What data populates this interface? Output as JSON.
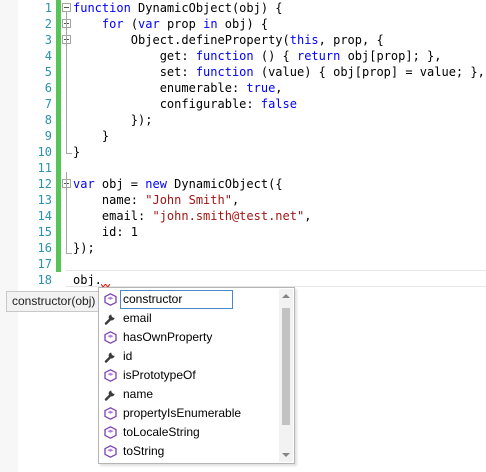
{
  "editor": {
    "lines": [
      {
        "num": "1",
        "tokens": [
          [
            "kw",
            "function"
          ],
          [
            "plain",
            " DynamicObject(obj) {"
          ]
        ]
      },
      {
        "num": "2",
        "tokens": [
          [
            "plain",
            "    "
          ],
          [
            "kw",
            "for"
          ],
          [
            "plain",
            " ("
          ],
          [
            "kw",
            "var"
          ],
          [
            "plain",
            " prop "
          ],
          [
            "kw",
            "in"
          ],
          [
            "plain",
            " obj) {"
          ]
        ]
      },
      {
        "num": "3",
        "tokens": [
          [
            "plain",
            "        Object.defineProperty("
          ],
          [
            "kw",
            "this"
          ],
          [
            "plain",
            ", prop, {"
          ]
        ]
      },
      {
        "num": "4",
        "tokens": [
          [
            "plain",
            "            get: "
          ],
          [
            "kw",
            "function"
          ],
          [
            "plain",
            " () { "
          ],
          [
            "kw",
            "return"
          ],
          [
            "plain",
            " obj[prop]; },"
          ]
        ]
      },
      {
        "num": "5",
        "tokens": [
          [
            "plain",
            "            set: "
          ],
          [
            "kw",
            "function"
          ],
          [
            "plain",
            " (value) { obj[prop] = value; },"
          ]
        ]
      },
      {
        "num": "6",
        "tokens": [
          [
            "plain",
            "            enumerable: "
          ],
          [
            "kw",
            "true"
          ],
          [
            "plain",
            ","
          ]
        ]
      },
      {
        "num": "7",
        "tokens": [
          [
            "plain",
            "            configurable: "
          ],
          [
            "kw",
            "false"
          ]
        ]
      },
      {
        "num": "8",
        "tokens": [
          [
            "plain",
            "        });"
          ]
        ]
      },
      {
        "num": "9",
        "tokens": [
          [
            "plain",
            "    }"
          ]
        ]
      },
      {
        "num": "10",
        "tokens": [
          [
            "plain",
            "}"
          ]
        ]
      },
      {
        "num": "11",
        "tokens": []
      },
      {
        "num": "12",
        "tokens": [
          [
            "kw",
            "var"
          ],
          [
            "plain",
            " obj = "
          ],
          [
            "kw",
            "new"
          ],
          [
            "plain",
            " DynamicObject({"
          ]
        ]
      },
      {
        "num": "13",
        "tokens": [
          [
            "plain",
            "    name: "
          ],
          [
            "str",
            "\"John Smith\""
          ],
          [
            "plain",
            ","
          ]
        ]
      },
      {
        "num": "14",
        "tokens": [
          [
            "plain",
            "    email: "
          ],
          [
            "str",
            "\"john.smith@test.net\""
          ],
          [
            "plain",
            ","
          ]
        ]
      },
      {
        "num": "15",
        "tokens": [
          [
            "plain",
            "    id: 1"
          ]
        ]
      },
      {
        "num": "16",
        "tokens": [
          [
            "plain",
            "});"
          ]
        ]
      },
      {
        "num": "17",
        "tokens": []
      },
      {
        "num": "18",
        "tokens": [
          [
            "plain",
            "obj."
          ]
        ]
      }
    ]
  },
  "colors": {
    "keyword": "#0000ff",
    "string": "#a31515",
    "line_number": "#2b91af",
    "changed_bar": "#57c457",
    "method_icon": "#7b3fb5",
    "property_icon": "#3c3c3c"
  },
  "tooltip": {
    "text": "constructor(obj)"
  },
  "completion": {
    "selected_index": 0,
    "items": [
      {
        "label": "constructor",
        "icon": "method-icon"
      },
      {
        "label": "email",
        "icon": "property-icon"
      },
      {
        "label": "hasOwnProperty",
        "icon": "method-icon"
      },
      {
        "label": "id",
        "icon": "property-icon"
      },
      {
        "label": "isPrototypeOf",
        "icon": "method-icon"
      },
      {
        "label": "name",
        "icon": "property-icon"
      },
      {
        "label": "propertyIsEnumerable",
        "icon": "method-icon"
      },
      {
        "label": "toLocaleString",
        "icon": "method-icon"
      },
      {
        "label": "toString",
        "icon": "method-icon"
      }
    ]
  }
}
